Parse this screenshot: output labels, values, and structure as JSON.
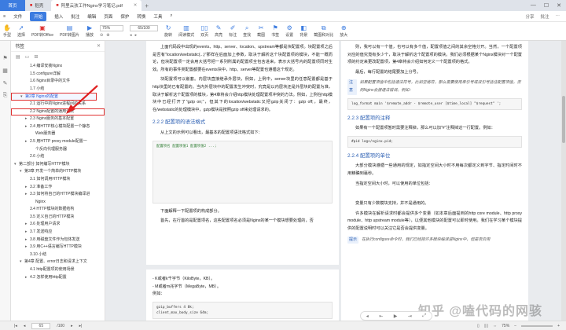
{
  "tabs": {
    "home": "首页",
    "t2": "稻壳",
    "active": "阿里云孩工作Nginx学习笔记.pdf"
  },
  "menu": {
    "file": "文件",
    "start": "开始",
    "items": [
      "插入",
      "批注",
      "编辑",
      "页面",
      "保护",
      "转换",
      "工具"
    ]
  },
  "menu_right": [
    "分享",
    "批注"
  ],
  "toolbar": {
    "items": [
      "手型",
      "选择",
      "PDF转Office",
      "PDF转图片",
      "播放",
      "旋转",
      "阅读模式",
      "高亮",
      "标注",
      "查找",
      "截图",
      "书签",
      "设置",
      "背景",
      "截图和对比",
      "放大"
    ],
    "zoom": "75%",
    "page_display": "65/100",
    "panel_label": "双页",
    "bg_label": "背景"
  },
  "toc": {
    "title": "书签",
    "items": [
      {
        "text": "1.4 编译安装Nginx",
        "level": 2,
        "caret": ""
      },
      {
        "text": "1.5 configure详解",
        "level": 2,
        "caret": ""
      },
      {
        "text": "1.6 Nginx目录中的文件",
        "level": 2,
        "caret": ""
      },
      {
        "text": "1.7 小结",
        "level": 2,
        "caret": ""
      },
      {
        "text": "第2章 Nginx的配置",
        "level": 1,
        "caret": "▾",
        "hl": true
      },
      {
        "text": "2.1 运行中的Nginx进程间的关系",
        "level": 2,
        "caret": ""
      },
      {
        "text": "2.2 Nginx配置的通用语法",
        "level": 2,
        "caret": "",
        "sel": true
      },
      {
        "text": "2.3 Nginx服务的基本配置",
        "level": 2,
        "caret": "▸"
      },
      {
        "text": "2.4 用HTTP核心模块配置一个静态",
        "level": 2,
        "caret": "▸"
      },
      {
        "text": "Web服务器",
        "level": 3,
        "caret": ""
      },
      {
        "text": "2.5 用HTTP proxy module配置一",
        "level": 2,
        "caret": "▸"
      },
      {
        "text": "个反向代理服务器",
        "level": 3,
        "caret": ""
      },
      {
        "text": "2.6 小结",
        "level": 2,
        "caret": ""
      },
      {
        "text": "第二部分 如何编写HTTP模块",
        "level": 0,
        "caret": "▾"
      },
      {
        "text": "第3章 开发一个简单的HTTP模块",
        "level": 1,
        "caret": "▾"
      },
      {
        "text": "3.1 如何调用HTTP模块",
        "level": 2,
        "caret": ""
      },
      {
        "text": "3.2 准备工作",
        "level": 2,
        "caret": "▸"
      },
      {
        "text": "3.3 如何将自己的HTTP模块编译进",
        "level": 2,
        "caret": "▸"
      },
      {
        "text": "Nginx",
        "level": 3,
        "caret": ""
      },
      {
        "text": "3.4 HTTP模块的数据结构",
        "level": 2,
        "caret": ""
      },
      {
        "text": "3.5 定义自己的HTTP模块",
        "level": 2,
        "caret": ""
      },
      {
        "text": "3.6 处理用户请求",
        "level": 2,
        "caret": "▸"
      },
      {
        "text": "3.7 发送响应",
        "level": 2,
        "caret": "▸"
      },
      {
        "text": "3.8 用磁盘文件作为包体发送",
        "level": 2,
        "caret": "▸"
      },
      {
        "text": "3.9 用C++语言编写HTTP模块",
        "level": 2,
        "caret": "▸"
      },
      {
        "text": "3.10 小结",
        "level": 2,
        "caret": ""
      },
      {
        "text": "第4章 配置、error日志和请求上下文",
        "level": 1,
        "caret": "▾"
      },
      {
        "text": "4.1 http配置项的使用场景",
        "level": 2,
        "caret": ""
      },
      {
        "text": "4.2 怎样使用http配置",
        "level": 2,
        "caret": "▸"
      }
    ]
  },
  "doc": {
    "p1": {
      "intro": "上面代码段中出现的events、http、server、location、upstream等都是块配置项。块配置项之后是否有\"location/webstatic{...}\"那样在后面加上参数，取决于解析这个块配置项的模块，不能一概而论，但块配置项一定会用大括号把一系列所属的配置项全包含进来，表示大括号内的配置项同时生效。所有的事件类配置都要在events块中，http、server等配置也遵循这个规定。",
      "para2": "块配置项可以嵌套。内层块直接继承外层块，例如，上例中，server块里的任意配置都是基于http块里的已有配置的。当内外层块中的配置发生冲突时，究竟是以内层块还是外层块的配置为准，取决于解析这个配置项的模块，第4章将会介绍http模块处理配置项冲突的方法。例如，上例在http模块中已经打开了\"gzip on;\"，但其下的location/webstatic又把gzip关闭了：gzip off;，最终，在/webstatic的处理模块中，gzip模块是按照gzip off来处理请求的。",
      "h_222": "2.2.2  配置项的语法格式",
      "para3": "从上文的示例可以看出，最基本的配置项语法格式如下：",
      "code": [
        "配置项名 配置项值1 配置项值2 ...;"
      ],
      "para4": "下面解释一下配置项的构成部分。",
      "para5": "首先，在行首的是配置项名，这些配置项名必须是Nginx的某一个模块想要处理的，否"
    },
    "p2": {
      "l1": "- K或者k千字节（KiloByte，KB）。",
      "l2": "- M或者m兆字节（MegaByte，MB）。",
      "l3": "例如：",
      "code": [
        "gzip_buffers      4 8k;",
        "client_max_body_size 64m;"
      ]
    },
    "p3": {
      "para1": "则，我可以有一个值，也可以有多个值，配置项值之间的其余空格分开。当然，一个配置项对应的值究竟有多少个，取决于解析这个配置项的模块。我们必须根据某个Nginx模块对一个配置项的约定来更改配置项，第4章将会介绍如何定义一个配置项的格式。",
      "para2": "最后，每行配置的结尾要加上分号。",
      "note_badge": "注意",
      "note": "如果配置项值中包括语法符号，比如空格符，那么需要使用单引号或双引号括住配置项值，否则Nginx会报语法错误。例如：",
      "code1": [
        "log_format  main  '$remote_addr - $remote_user [$time_local] \"$request\" ';"
      ],
      "h_223": "2.2.3  配置项的注释",
      "para3": "如果有一个配置项暂时需要注释掉，那么可以加\"#\"注释掉这一行配置。例如：",
      "code2": [
        "#pid        logs/nginx.pid;"
      ],
      "h_224": "2.2.4  配置项的单位",
      "para4": "大部分模块遵循一些通用的规定，如指定空间大小时不用每次都定义到字节、指定时间时不用精确到毫秒。",
      "para5": "当指定空间大小时，可以使用的单位包括：",
      "para6": "变量只有少数模块支持，并不是通用的。",
      "para7": "许多模块在解析请求时都会提供多个变量（如本章后面提到的http core module、http proxy module、http upstream module等），以便其他模块的配置可以即时使用。我们在学习某个模块提供的配置说明时可以关注它是否会提供变量。",
      "note2_badge": "提示",
      "note2": "在执行configure命令时，我们已经把许多模块编译进Nginx中，但是否启用"
    },
    "watermark": "知乎 @嗑代码的网骇"
  },
  "status": {
    "pages": "65",
    "total": "/100",
    "zoom": "75%"
  }
}
